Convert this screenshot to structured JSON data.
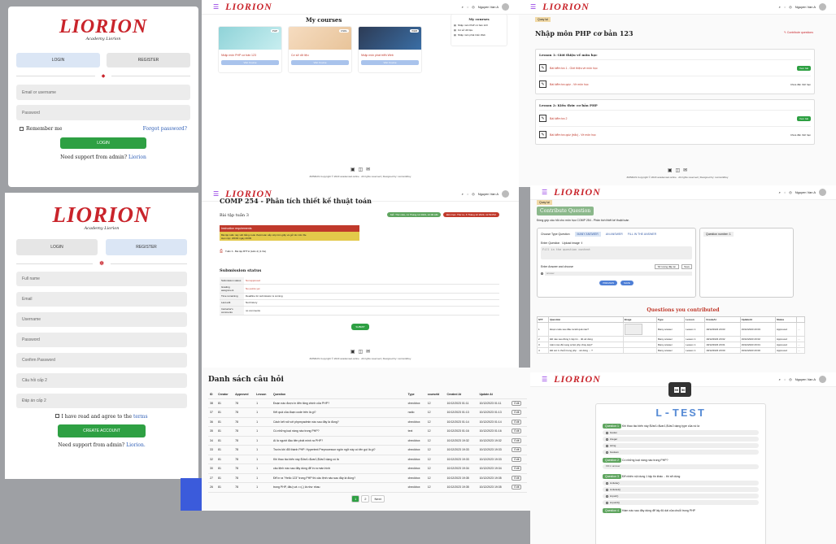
{
  "brand": "LIORION",
  "brand_sub": "Academy Liorion",
  "login": {
    "tab_login": "LOGIN",
    "tab_register": "REGISTER",
    "username_placeholder": "Email or username",
    "password_placeholder": "Password",
    "remember": "Remember me",
    "forgot": "Forgot password?",
    "submit": "LOGIN",
    "support_text": "Need support from admin?",
    "support_link": "Liorion"
  },
  "register": {
    "tab_login": "LOGIN",
    "tab_register": "REGISTER",
    "fields": [
      "Full name",
      "Email",
      "Username",
      "Password",
      "Confirm Password",
      "Câu hỏi cấp 2",
      "Đáp án cấp 2"
    ],
    "agree_prefix": "I have read and agree to the",
    "agree_link": "terms",
    "submit": "CREATE ACCOUNT",
    "support_text": "Need support from admin?",
    "support_link": "Liorion."
  },
  "nav": {
    "user": "Nguyen Van A"
  },
  "courses": {
    "title": "My courses",
    "side_title": "My courses",
    "side_items": [
      "Nhập môn PHP cơ bản 123",
      "Cơ sở dữ liệu",
      "Nhập môn phát triển Web"
    ],
    "cards": [
      {
        "badge": "PHP",
        "title": "Nhập môn PHP cơ bản 123",
        "button": "Visit Course"
      },
      {
        "badge": "CSDL",
        "title": "Cơ sở dữ liệu",
        "button": "Visit Course"
      },
      {
        "badge": "WEB",
        "title": "Nhập môn phát triển Web",
        "button": "Visit Course"
      }
    ]
  },
  "footer": "ZMNRAS Copyright © 2023 academaul.online · All rights reserved | Designed by: Liorion&Duy",
  "course_detail": {
    "crumb": "Quay lại",
    "title": "Nhập môn PHP cơ bản 123",
    "contribute": "Contribute questions",
    "lessons": [
      {
        "title": "Lesson 1: Giới thiệu về môn học",
        "items": [
          {
            "name": "Bài kiểm tra 1 - Giới thiệu về môn học",
            "action": "Xem bài"
          },
          {
            "name": "Bài kiểm tra quiz - Về môn học",
            "action": "Chưa đến thời hạn"
          }
        ]
      },
      {
        "title": "Lesson 2: Kiến thức cơ bản PHP",
        "items": [
          {
            "name": "Bài kiểm tra 2",
            "action": "Xem bài"
          },
          {
            "name": "Bài kiểm tra quiz (trắc) - Về môn học",
            "action": "Chưa đến thời hạn"
          }
        ]
      }
    ]
  },
  "assignment": {
    "title": "COMP 254 - Phân tích thiết kế thuật toán",
    "name": "Bài tập tuần 3",
    "opened": "Mở: Thứ năm, 11 Tháng 12 2023, 12:00 AM",
    "due": "Đến hạn: Thứ tư, 6 Tháng 12 2023, 11:59 PM",
    "req_title": "Instruction requirements",
    "req_lines": [
      "Bài tập tuần này viết bằng code thuật toán sắp xếp trên giấy và gửi lên trên file",
      "Hạn nộp: 20h00 ngày 20/09"
    ],
    "file": "Tuần 3 - Bài tập BTTH (tuần 4) (1 file)",
    "status_title": "Submission status",
    "status_rows": [
      [
        "Submission status",
        "Not approved"
      ],
      [
        "Grading assignment",
        "No points yet"
      ],
      [
        "Time remaining",
        "Deadline for submission is coming"
      ],
      [
        "Last edit",
        "Not history"
      ],
      [
        "Instructor's comments",
        "no comments"
      ]
    ],
    "submit": "SUBMIT"
  },
  "contribute": {
    "crumb": "Quay lại",
    "title": "Contribute Question",
    "subtitle": "Đóng góp câu hỏi cho môn học COMP 254 - Phân tích thiết kế thuật toán",
    "type_label": "Choose Type Question",
    "types": [
      "MANY ANSWER",
      "AN ANSWER",
      "FILL IN THE ANSWER"
    ],
    "q_label": "Enter Question",
    "upload": "Upload image",
    "q_placeholder": "Fill in the question content",
    "ans_label": "Enter Answer and choose",
    "ans_select": "Số lượng đáp án",
    "ans_btn": "Save",
    "ans_placeholder": "answer",
    "preview": "PREVIEW",
    "save": "SAVE",
    "qnum": "Question number: 1",
    "table_title": "Questions you contributed",
    "cols": [
      "STT",
      "Question",
      "Image",
      "Type",
      "Lesson",
      "CreateAt",
      "UpdateAt",
      "Status",
      ""
    ],
    "rows": [
      [
        "1",
        "Đoạn code sau đâu ra kết quả nào?",
        "",
        "Many answer",
        "Lesson 1",
        "19/12/2023 20:03",
        "19/12/2023 20:03",
        "Approved",
        "···"
      ],
      [
        "2",
        "Đề nào sau đúng 1 tập tin .. đó sẽ dùng",
        "",
        "Many answer",
        "Lesson 1",
        "19/12/2023 20:02",
        "19/12/2023 20:02",
        "Approved",
        "···"
      ],
      [
        "3",
        "Hàm nào để nạng script php chay kép?",
        "",
        "Many answer",
        "Lesson 1",
        "19/12/2023 20:01",
        "19/12/2023 20:01",
        "Approved",
        "···"
      ],
      [
        "4",
        "Đề xét 1 chuỗi trong php .. sẽ dùng ... ?",
        "",
        "Many answer",
        "Lesson 1",
        "19/12/2023 20:00",
        "19/12/2023 20:00",
        "Approved",
        "···"
      ]
    ]
  },
  "questions": {
    "title": "Danh sách câu hỏi",
    "cols": [
      "ID",
      "Creator",
      "Approved",
      "Lesson",
      "Question",
      "Type",
      "courseId",
      "Created At",
      "Update At",
      ""
    ],
    "rows": [
      [
        "38",
        "81",
        "78",
        "1",
        "Đoạn nào được in đến tăng chính của PHP?",
        "checkbox",
        "12",
        "10/12/2023 01:11",
        "10/12/2023 01:11",
        "Edit"
      ],
      [
        "37",
        "81",
        "78",
        "1",
        "Kết quả của đoạn code trên là gì?",
        "radio",
        "12",
        "10/12/2023 01:13",
        "10/12/2023 01:13",
        "Edit"
      ],
      [
        "36",
        "81",
        "78",
        "1",
        "Cách kết nối với phpmyadmin nào sau đây là đúng?",
        "checkbox",
        "12",
        "10/12/2023 01:14",
        "10/12/2023 01:14",
        "Edit"
      ],
      [
        "35",
        "81",
        "78",
        "1",
        "Cú những loại nàng nào trong PHP?",
        "text",
        "12",
        "10/12/2023 01:16",
        "10/12/2023 01:16",
        "Edit"
      ],
      [
        "34",
        "81",
        "78",
        "1",
        "Ai là người đầu tiên phát minh ra PHP?",
        "checkbox",
        "12",
        "10/12/2023 19:32",
        "10/12/2023 19:32",
        "Edit"
      ],
      [
        "33",
        "81",
        "78",
        "1",
        "Trước khi đổi thành PHP: Hypertext Preprocessor ngôn ngữ này có tên gọi là gì?",
        "checkbox",
        "12",
        "10/12/2023 19:33",
        "10/12/2023 19:33",
        "Edit"
      ],
      [
        "32",
        "81",
        "78",
        "1",
        "Khi thao tác biến này $Var1=$var1,$Var2 dạng cú là",
        "checkbox",
        "12",
        "10/12/2023 19:33",
        "10/12/2023 19:33",
        "Edit"
      ],
      [
        "30",
        "81",
        "78",
        "1",
        "câu lệnh nào sau đây dùng để in ra màn hình",
        "checkbox",
        "12",
        "10/12/2023 19:34",
        "10/12/2023 19:34",
        "Edit"
      ],
      [
        "27",
        "81",
        "78",
        "1",
        "Để in ra \"Hello 123\" trong PHP thì câu lệnh nào sau đây là đúng?",
        "checkbox",
        "12",
        "10/12/2023 19:35",
        "10/12/2023 19:35",
        "Edit"
      ],
      [
        "26",
        "81",
        "78",
        "1",
        "trong PHP, đâu) và ==(-) là như nhau",
        "checkbox",
        "12",
        "10/12/2023 19:35",
        "10/12/2023 19:35",
        "Edit"
      ]
    ],
    "pages": [
      "1",
      "2",
      "Next"
    ]
  },
  "ltest": {
    "timer": [
      "59",
      "50"
    ],
    "title": "L-TEST",
    "q1_tag": "Question 1",
    "q1": "Khi thao tác biến này $Var1=$var1,$Var2 dạng type của nó là",
    "q1_opts": [
      "boolen",
      "integer",
      "string",
      "boolean"
    ],
    "q2_tag": "Question 2",
    "q2": "Có những loại nàng nào trong PHP?",
    "q2_fill": "Fill in answer",
    "q3_tag": "Question 3",
    "q3": "Để nhiên nội dung 1 tập tin khác .. thì sẽ dùng",
    "q3_opts": [
      "include()",
      "include1()",
      "import()",
      "import2()"
    ],
    "q4_tag": "Question 4",
    "q4": "Hàm nào sau đây dùng để lấy độ dài của chuỗi trong PHP"
  }
}
